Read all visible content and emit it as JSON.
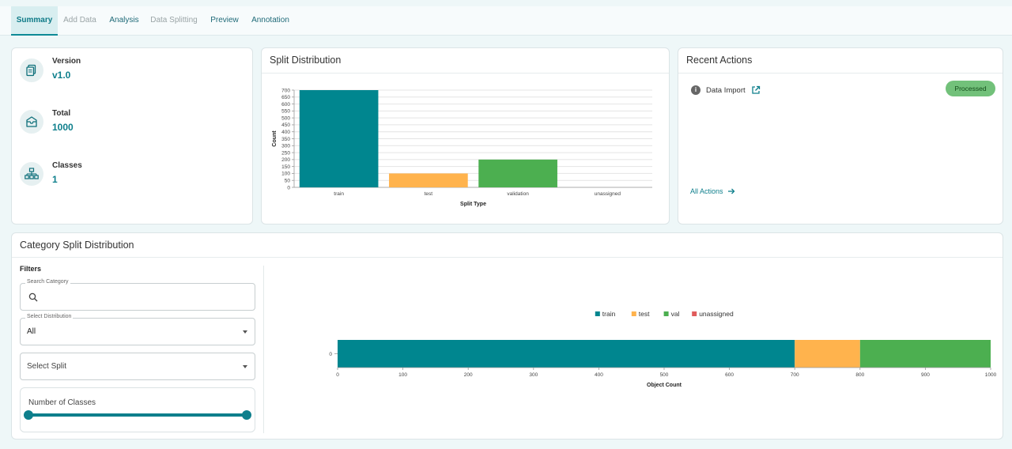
{
  "tabs": [
    {
      "label": "Summary",
      "active": true
    },
    {
      "label": "Add Data",
      "active": false,
      "muted": true
    },
    {
      "label": "Analysis",
      "active": false,
      "muted": false
    },
    {
      "label": "Data Splitting",
      "active": false,
      "muted": true
    },
    {
      "label": "Preview",
      "active": false,
      "muted": false
    },
    {
      "label": "Annotation",
      "active": false,
      "muted": false
    }
  ],
  "stats": {
    "version": {
      "label": "Version",
      "value": "v1.0",
      "icon": "copy-icon"
    },
    "total": {
      "label": "Total",
      "value": "1000",
      "icon": "inbox-icon"
    },
    "classes": {
      "label": "Classes",
      "value": "1",
      "icon": "hierarchy-icon"
    }
  },
  "split_card": {
    "title": "Split Distribution"
  },
  "recent_actions": {
    "title": "Recent Actions",
    "items": [
      {
        "label": "Data Import",
        "status": "Processed"
      }
    ],
    "all_actions_label": "All Actions"
  },
  "category_card": {
    "title": "Category Split Distribution"
  },
  "filters": {
    "title": "Filters",
    "search": {
      "legend": "Search Category",
      "value": ""
    },
    "distribution": {
      "legend": "Select Distribution",
      "value": "All"
    },
    "split": {
      "placeholder": "Select Split"
    },
    "num_classes": {
      "label": "Number of Classes",
      "min_fraction": 0,
      "max_fraction": 1
    }
  },
  "colors": {
    "train": "#00868f",
    "test": "#ffb34d",
    "validation": "#4caf50",
    "unassigned": "#e05c5c",
    "accent": "#0e7f8c"
  },
  "chart_data": [
    {
      "type": "bar",
      "categories": [
        "train",
        "test",
        "validation",
        "unassigned"
      ],
      "values": [
        700,
        100,
        200,
        0
      ],
      "xlabel": "Split Type",
      "ylabel": "Count",
      "ylim": [
        0,
        700
      ],
      "yticks": [
        0,
        50,
        100,
        150,
        200,
        250,
        300,
        350,
        400,
        450,
        500,
        550,
        600,
        650,
        700
      ],
      "grid": true
    },
    {
      "type": "bar",
      "orientation": "horizontal",
      "stacked": true,
      "categories": [
        "0"
      ],
      "series": [
        {
          "name": "train",
          "values": [
            700
          ]
        },
        {
          "name": "test",
          "values": [
            100
          ]
        },
        {
          "name": "val",
          "values": [
            200
          ]
        },
        {
          "name": "unassigned",
          "values": [
            0
          ]
        }
      ],
      "xlabel": "Object Count",
      "xlim": [
        0,
        1000
      ],
      "xticks": [
        0,
        100,
        200,
        300,
        400,
        500,
        600,
        700,
        800,
        900,
        1000
      ],
      "legend": "top"
    }
  ]
}
